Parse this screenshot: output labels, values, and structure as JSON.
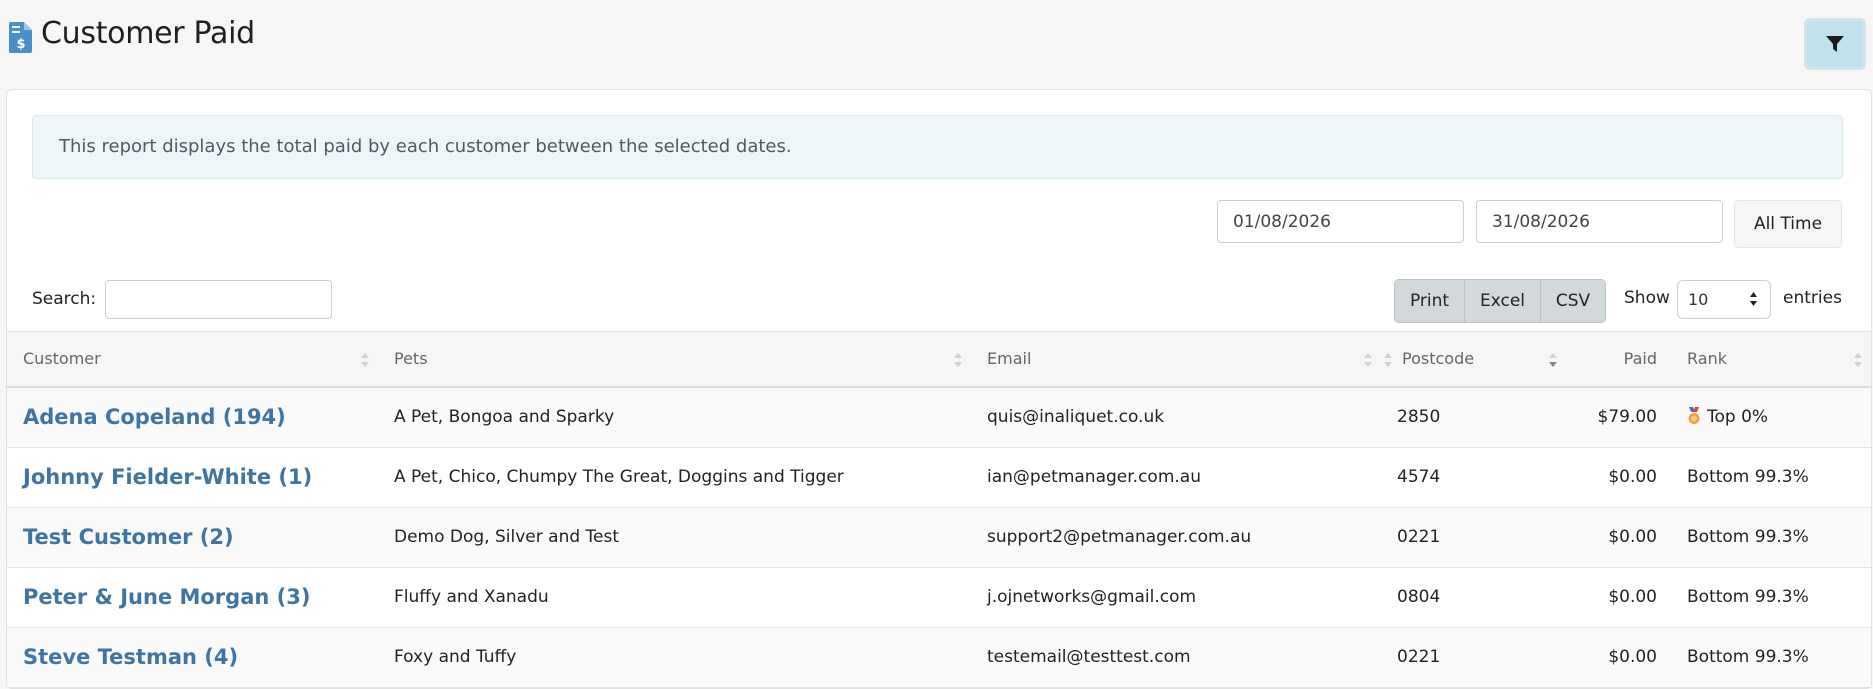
{
  "page": {
    "title": "Customer Paid",
    "title_icon": "invoice-dollar-icon",
    "filter_icon": "filter-funnel-icon"
  },
  "info": {
    "text": "This report displays the total paid by each customer between the selected dates."
  },
  "date_range": {
    "from": "01/08/2026",
    "to": "31/08/2026",
    "all_time_label": "All Time"
  },
  "search": {
    "label": "Search:",
    "value": ""
  },
  "export_buttons": {
    "print": "Print",
    "excel": "Excel",
    "csv": "CSV"
  },
  "entries": {
    "show_label": "Show",
    "value": "10",
    "suffix_label": "entries"
  },
  "table": {
    "columns": [
      "Customer",
      "Pets",
      "Email",
      "Postcode",
      "Paid",
      "Rank"
    ],
    "sorted_column": "Postcode",
    "rows": [
      {
        "customer": "Adena Copeland (194)",
        "pets": "A Pet, Bongoa and Sparky",
        "email": "quis@inaliquet.co.uk",
        "postcode": "2850",
        "paid": "$79.00",
        "rank": "Top 0%",
        "rank_icon": "medal-icon"
      },
      {
        "customer": "Johnny Fielder-White (1)",
        "pets": "A Pet, Chico, Chumpy The Great, Doggins and Tigger",
        "email": "ian@petmanager.com.au",
        "postcode": "4574",
        "paid": "$0.00",
        "rank": "Bottom 99.3%"
      },
      {
        "customer": "Test Customer (2)",
        "pets": "Demo Dog, Silver and Test",
        "email": "support2@petmanager.com.au",
        "postcode": "0221",
        "paid": "$0.00",
        "rank": "Bottom 99.3%"
      },
      {
        "customer": "Peter & June Morgan (3)",
        "pets": "Fluffy and Xanadu",
        "email": "j.ojnetworks@gmail.com",
        "postcode": "0804",
        "paid": "$0.00",
        "rank": "Bottom 99.3%"
      },
      {
        "customer": "Steve Testman (4)",
        "pets": "Foxy and Tuffy",
        "email": "testemail@testtest.com",
        "postcode": "0221",
        "paid": "$0.00",
        "rank": "Bottom 99.3%"
      }
    ]
  },
  "colors": {
    "link": "#3f74a3",
    "info_bg": "#eef6f9",
    "filter_button_bg": "#bfe2ee",
    "export_button_bg": "#d3d8db",
    "title_icon": "#4a90c8",
    "medal": "#f0a040"
  }
}
